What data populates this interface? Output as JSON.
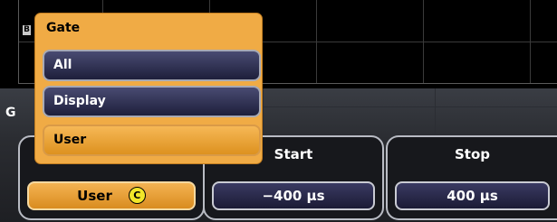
{
  "screen": {
    "channel_badge": "B"
  },
  "panel": {
    "label": "G"
  },
  "gate_menu": {
    "title": "Gate",
    "options": [
      {
        "label": "All",
        "selected": false
      },
      {
        "label": "Display",
        "selected": false
      },
      {
        "label": "User",
        "selected": true
      }
    ]
  },
  "settings": {
    "gate": {
      "value": "User",
      "icon": "c-circle-icon",
      "icon_glyph": "C"
    },
    "start": {
      "title": "Start",
      "value": "−400 µs"
    },
    "stop": {
      "title": "Stop",
      "value": "400 µs"
    }
  },
  "colors": {
    "accent": "#f0ab45",
    "value_box": "#2a2b4c",
    "badge": "#f2e629"
  }
}
